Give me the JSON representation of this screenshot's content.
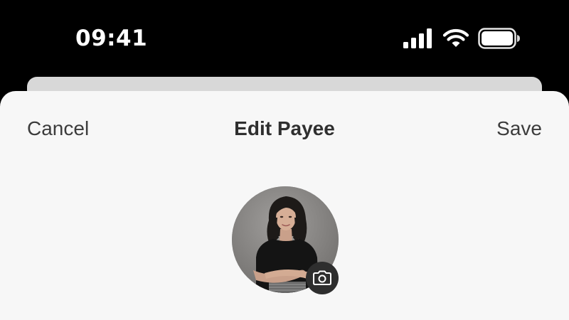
{
  "status_bar": {
    "time": "09:41",
    "icons": [
      "cellular-signal-icon",
      "wifi-icon",
      "battery-icon"
    ],
    "text_color": "#ffffff",
    "background": "#000000"
  },
  "nav": {
    "cancel_label": "Cancel",
    "title": "Edit Payee",
    "save_label": "Save"
  },
  "avatar": {
    "image": "payee-photo",
    "edit_icon": "camera-icon"
  },
  "colors": {
    "sheet_background": "#f7f7f7",
    "back_card": "#d8d8d8",
    "nav_text": "#3c3c3c",
    "camera_badge": "#2e2e2e"
  }
}
